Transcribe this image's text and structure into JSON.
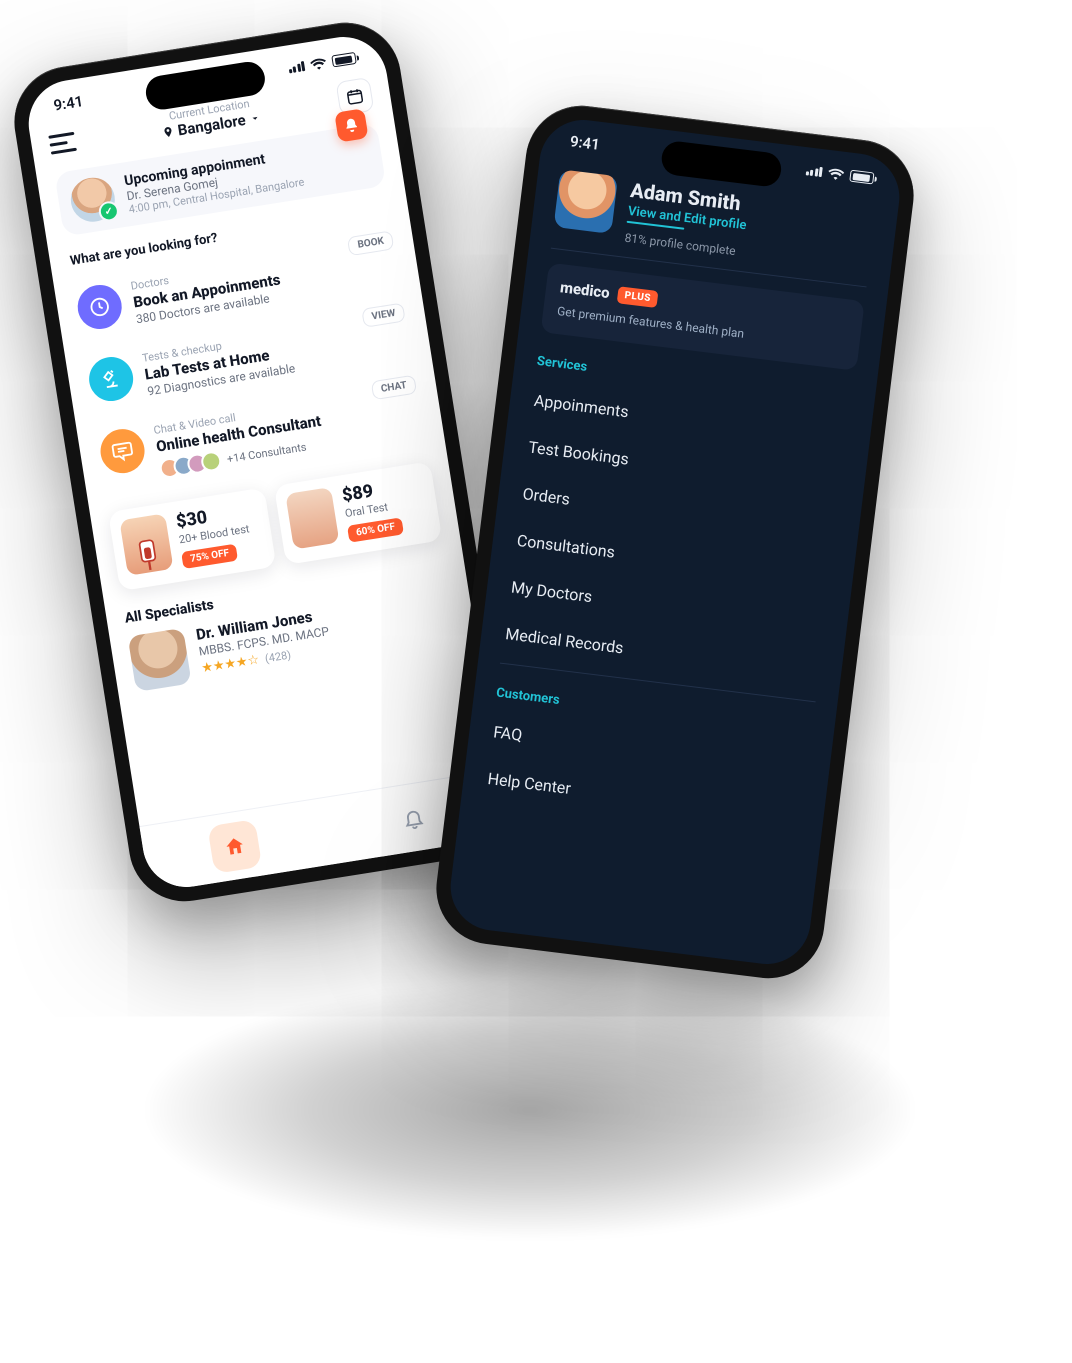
{
  "status": {
    "time": "9:41"
  },
  "phoneA": {
    "header": {
      "location_label": "Current Location",
      "location": "Bangalore"
    },
    "upcoming": {
      "title": "Upcoming appoinment",
      "doctor": "Dr. Serena Gomej",
      "detail": "4:00 pm, Central Hospital, Bangalore"
    },
    "question": "What are you looking for?",
    "options": [
      {
        "chip": "BOOK",
        "meta": "Doctors",
        "title": "Book an Appoinments",
        "sub": "380 Doctors are available"
      },
      {
        "chip": "VIEW",
        "meta": "Tests & checkup",
        "title": "Lab Tests at Home",
        "sub": "92 Diagnostics are available"
      },
      {
        "chip": "CHAT",
        "meta": "Chat & Video call",
        "title": "Online health Consultant",
        "sub": "+14 Consultants",
        "consultants": true
      }
    ],
    "offers": [
      {
        "price": "$30",
        "desc": "20+ Blood test",
        "badge": "75% OFF"
      },
      {
        "price": "$89",
        "desc": "Oral Test",
        "badge": "60% OFF"
      }
    ],
    "specialists": {
      "heading": "All Specialists",
      "name": "Dr. William Jones",
      "qual": "MBBS. FCPS. MD. MACP",
      "stars": "★★★★☆",
      "reviews": "(428)"
    }
  },
  "phoneB": {
    "profile": {
      "name": "Adam Smith",
      "edit": "View and Edit profile",
      "progress": "81% profile complete"
    },
    "plus": {
      "brand": "medico",
      "badge": "PLUS",
      "sub": "Get premium features & health plan"
    },
    "servicesHeading": "Services",
    "services": [
      "Appoinments",
      "Test Bookings",
      "Orders",
      "Consultations",
      "My Doctors",
      "Medical Records"
    ],
    "customersHeading": "Customers",
    "customers": [
      "FAQ",
      "Help Center"
    ]
  }
}
